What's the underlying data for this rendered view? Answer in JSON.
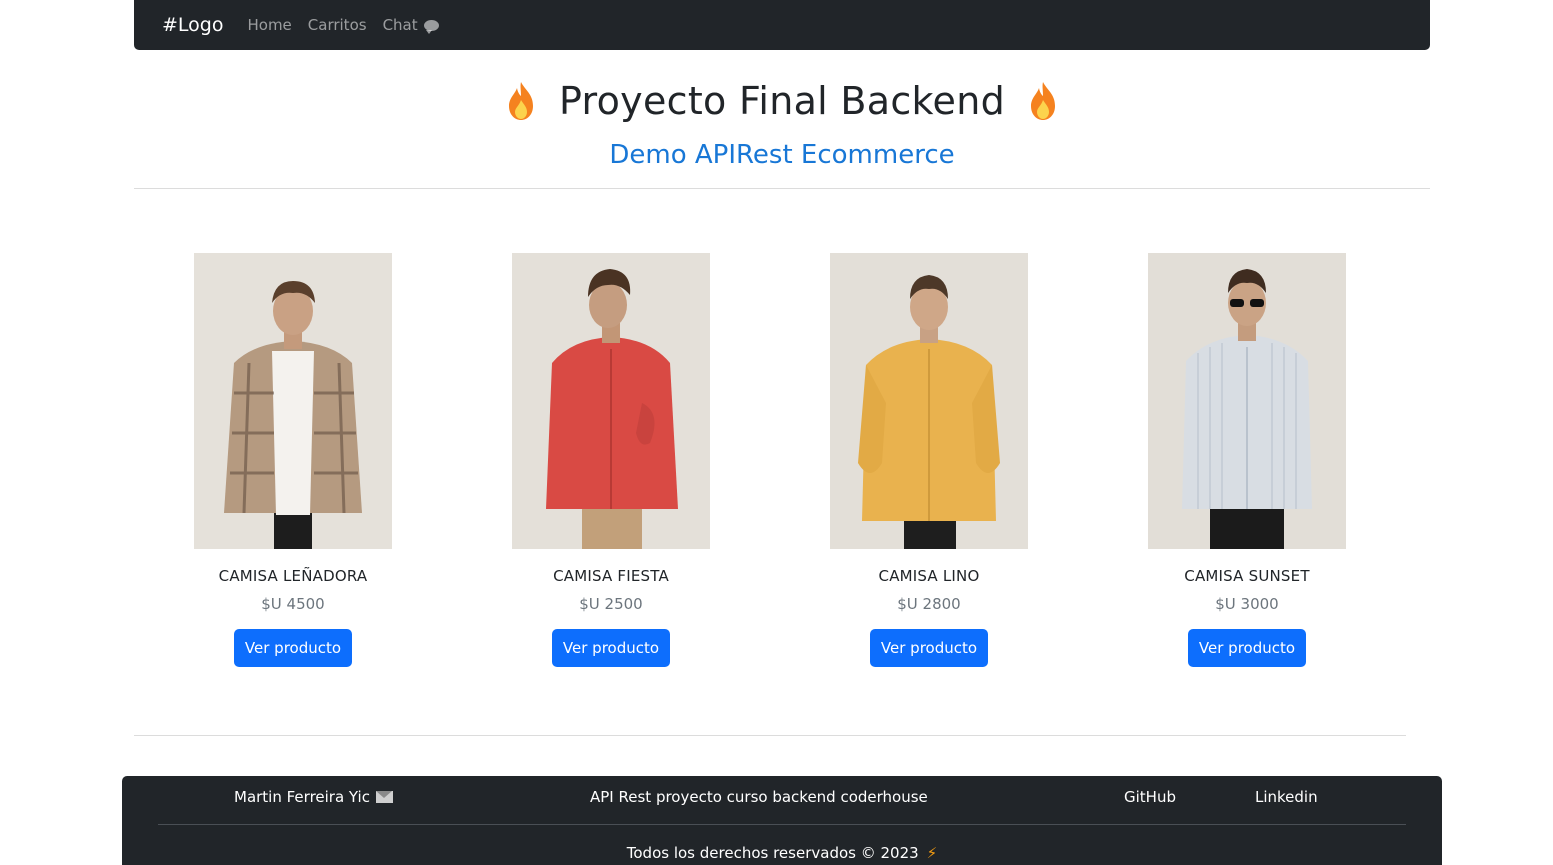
{
  "nav": {
    "brand": "#Logo",
    "links": [
      "Home",
      "Carritos",
      "Chat"
    ]
  },
  "hero": {
    "title": "Proyecto Final Backend",
    "subtitle": "Demo APIRest Ecommerce"
  },
  "products": [
    {
      "name": "CAMISA LEÑADORA",
      "price": "$U 4500",
      "button": "Ver producto",
      "shirt_color": "#b59a80"
    },
    {
      "name": "CAMISA FIESTA",
      "price": "$U 2500",
      "button": "Ver producto",
      "shirt_color": "#d94a44"
    },
    {
      "name": "CAMISA LINO",
      "price": "$U 2800",
      "button": "Ver producto",
      "shirt_color": "#e9b24e"
    },
    {
      "name": "CAMISA SUNSET",
      "price": "$U 3000",
      "button": "Ver producto",
      "shirt_color": "#d8dde3"
    }
  ],
  "footer": {
    "author": "Martin Ferreira Yic",
    "description": "API Rest proyecto curso backend coderhouse",
    "links": [
      "GitHub",
      "Linkedin"
    ],
    "copyright": "Todos los derechos reservados © 2023"
  },
  "colors": {
    "navbar": "#212529",
    "accent": "#0d6efd",
    "subtitle": "#1877d6",
    "flame": "#f5821f"
  },
  "icons": {
    "chat": "chat-bubble-icon",
    "flame": "fire-icon",
    "mail": "envelope-icon",
    "bolt": "lightning-icon"
  }
}
